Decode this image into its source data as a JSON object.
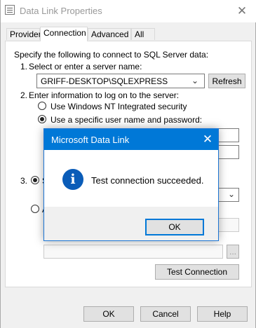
{
  "window": {
    "title": "Data Link Properties",
    "tabs": [
      "Provider",
      "Connection",
      "Advanced",
      "All"
    ]
  },
  "connection": {
    "intro": "Specify the following to connect to SQL Server data:",
    "step1_num": "1.",
    "step1_label": "Select or enter a server name:",
    "server_value": "GRIFF-DESKTOP\\SQLEXPRESS",
    "refresh_label": "Refresh",
    "step2_num": "2.",
    "step2_label": "Enter information to log on to the server:",
    "radio_nt_label": "Use Windows NT Integrated security",
    "radio_specific_label": "Use a specific user name and password:",
    "step3_num": "3.",
    "step3_radio_letter": "S",
    "attach_radio_letter": "A",
    "browse_label": "...",
    "test_connection_label": "Test Connection"
  },
  "footer": {
    "ok_label": "OK",
    "cancel_label": "Cancel",
    "help_label": "Help"
  },
  "modal": {
    "title": "Microsoft Data Link",
    "icon": "info-icon",
    "icon_glyph": "i",
    "message": "Test connection succeeded.",
    "ok_label": "OK"
  },
  "colors": {
    "accent": "#0078d7",
    "info_icon": "#0a5cb8"
  }
}
